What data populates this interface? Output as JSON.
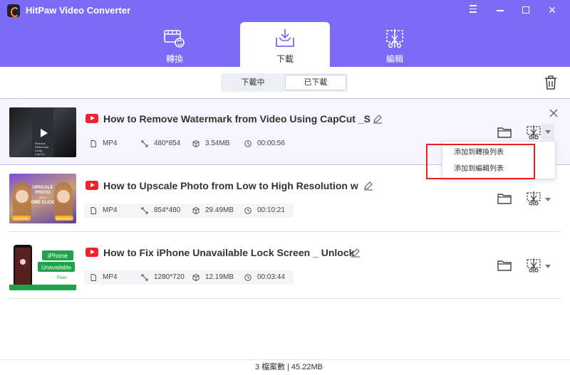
{
  "app": {
    "title": "HitPaw Video Converter"
  },
  "tabs": [
    {
      "id": "convert",
      "label": "轉換"
    },
    {
      "id": "download",
      "label": "下載"
    },
    {
      "id": "edit",
      "label": "編輯"
    }
  ],
  "subtabs": {
    "downloading": "下載中",
    "downloaded": "已下載"
  },
  "items": [
    {
      "title": "How to Remove Watermark from Video Using CapCut _S",
      "format": "MP4",
      "resolution": "480*854",
      "size": "3.54MB",
      "duration": "00:00:56",
      "thumb_text": [
        "Remove",
        "Watermark",
        "Using",
        "CapCut"
      ]
    },
    {
      "title": "How to Upscale Photo from Low to High Resolution w",
      "format": "MP4",
      "resolution": "854*480",
      "size": "29.49MB",
      "duration": "00:10:21",
      "thumb_text": [
        "UPSCALE",
        "PHOTO",
        "WITH",
        "ONE CLICK",
        "ORIGINAL",
        "ENHANCED"
      ]
    },
    {
      "title": "How to Fix iPhone Unavailable Lock Screen _ Unlock",
      "format": "MP4",
      "resolution": "1280*720",
      "size": "12.19MB",
      "duration": "00:03:44",
      "thumb_text": [
        "iPhone",
        "Unavailable",
        "Fixes"
      ]
    }
  ],
  "dropdown": {
    "add_convert": "添加到轉換列表",
    "add_edit": "添加到編輯列表"
  },
  "footer": {
    "count": "3 檔案數",
    "total_size": "| 45.22MB"
  },
  "colors": {
    "header": "#7a6cf7",
    "accent": "#7a6cf7",
    "youtube": "#f0232d",
    "highlight": "#e52020"
  },
  "icons": [
    "convert-icon",
    "download-icon",
    "edit-icon",
    "trash-icon",
    "youtube-icon",
    "pencil-icon",
    "file-icon",
    "resolution-icon",
    "size-icon",
    "clock-icon",
    "folder-icon",
    "cut-icon",
    "close-icon",
    "caret-down-icon"
  ]
}
